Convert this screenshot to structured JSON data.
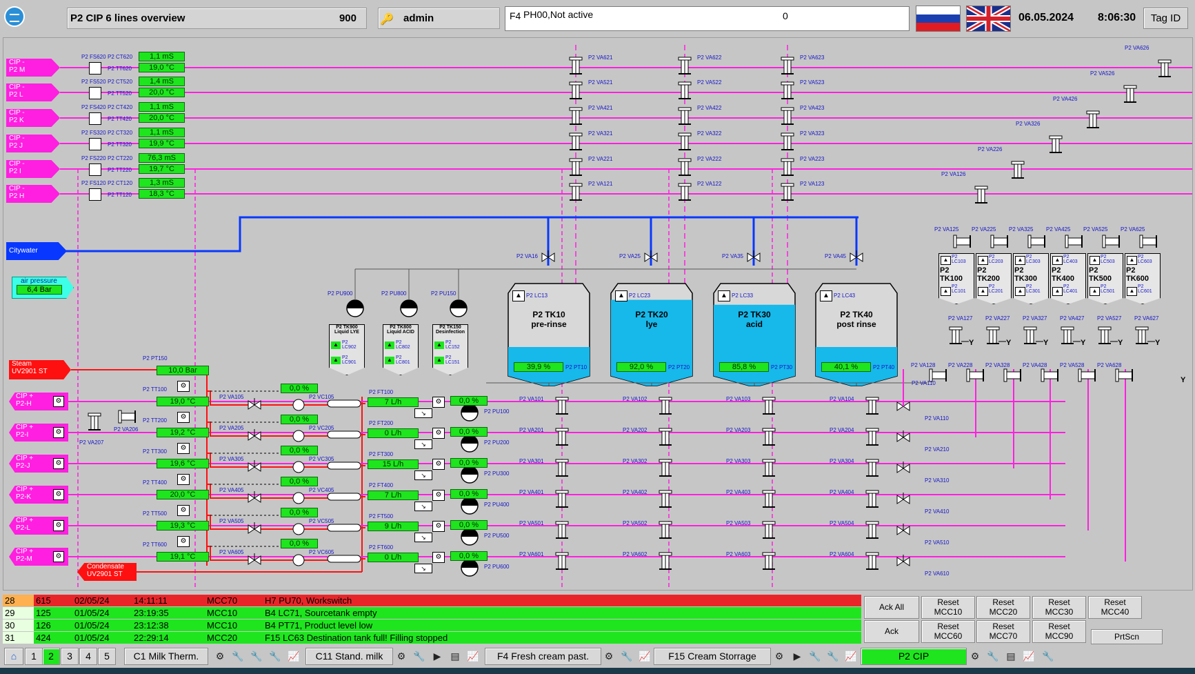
{
  "header": {
    "title": "P2 CIP 6 lines overview",
    "screen_no": "900",
    "user": "admin",
    "alarm_key": "F4",
    "alarm_text": "PH00,Not active",
    "alarm_count": "0",
    "date": "06.05.2024",
    "time": "8:06:30",
    "tag_id_label": "Tag ID"
  },
  "sources": [
    {
      "label1": "CIP -",
      "label2": "P2 M"
    },
    {
      "label1": "CIP -",
      "label2": "P2 L"
    },
    {
      "label1": "CIP -",
      "label2": "P2 K"
    },
    {
      "label1": "CIP -",
      "label2": "P2 J"
    },
    {
      "label1": "CIP -",
      "label2": "P2 I"
    },
    {
      "label1": "CIP -",
      "label2": "P2 H"
    }
  ],
  "return_lines": [
    {
      "fs": "P2 FS620",
      "ct": "P2 CT620",
      "tt": "P2 TT620",
      "ct_val": "1,1 mS",
      "tt_val": "19,0 °C"
    },
    {
      "fs": "P2 FS520",
      "ct": "P2 CT520",
      "tt": "P2 TT520",
      "ct_val": "1,4 mS",
      "tt_val": "20,0 °C"
    },
    {
      "fs": "P2 FS420",
      "ct": "P2 CT420",
      "tt": "P2 TT420",
      "ct_val": "1,1 mS",
      "tt_val": "20,0 °C"
    },
    {
      "fs": "P2 FS320",
      "ct": "P2 CT320",
      "tt": "P2 TT320",
      "ct_val": "1,1 mS",
      "tt_val": "19,9 °C"
    },
    {
      "fs": "P2 FS220",
      "ct": "P2 CT220",
      "tt": "P2 TT220",
      "ct_val": "76,3 mS",
      "tt_val": "19,7 °C"
    },
    {
      "fs": "P2 FS120",
      "ct": "P2 CT120",
      "tt": "P2 TT120",
      "ct_val": "1,3 mS",
      "tt_val": "18,3 °C"
    }
  ],
  "valve_rows": [
    [
      "P2 VA621",
      "P2 VA622",
      "P2 VA623"
    ],
    [
      "P2 VA521",
      "P2 VA522",
      "P2 VA523"
    ],
    [
      "P2 VA421",
      "P2 VA422",
      "P2 VA423"
    ],
    [
      "P2 VA321",
      "P2 VA322",
      "P2 VA323"
    ],
    [
      "P2 VA221",
      "P2 VA222",
      "P2 VA223"
    ],
    [
      "P2 VA121",
      "P2 VA122",
      "P2 VA123"
    ]
  ],
  "right_top_valves": [
    "P2 VA626",
    "P2 VA526",
    "P2 VA426",
    "P2 VA326",
    "P2 VA226",
    "P2 VA126"
  ],
  "citywater": "Citywater",
  "air_pressure": {
    "label": "air pressure",
    "value": "6,4 Bar"
  },
  "steam": {
    "label1": "Steam",
    "label2": "UV2901 ST",
    "pt": "P2 PT150",
    "value": "10,0 Bar"
  },
  "condensate": {
    "label1": "Condensate",
    "label2": "UV2901 ST"
  },
  "water_valves": [
    "P2 VA16",
    "P2 VA25",
    "P2 VA35",
    "P2 VA45"
  ],
  "dosing": [
    {
      "pump": "P2 PU900",
      "name1": "P2 TK900",
      "name2": "Liquid LYE",
      "lc1": "P2 LC902",
      "lc2": "P2 LC901"
    },
    {
      "pump": "P2 PU800",
      "name1": "P2 TK800",
      "name2": "Liquid ACID",
      "lc1": "P2 LC802",
      "lc2": "P2 LC801"
    },
    {
      "pump": "P2 PU150",
      "name1": "P2 TK150",
      "name2": "Desinfection",
      "lc1": "P2 LC152",
      "lc2": "P2 LC151"
    }
  ],
  "tanks": [
    {
      "lc": "P2 LC13",
      "name": "P2 TK10",
      "sub": "pre-rinse",
      "level": "39,9 %",
      "level_pct": 35,
      "pt": "P2 PT10"
    },
    {
      "lc": "P2 LC23",
      "name": "P2 TK20",
      "sub": "lye",
      "level": "92,0 %",
      "level_pct": 92,
      "pt": "P2 PT20"
    },
    {
      "lc": "P2 LC33",
      "name": "P2 TK30",
      "sub": "acid",
      "level": "85,8 %",
      "level_pct": 86,
      "pt": "P2 PT30"
    },
    {
      "lc": "P2 LC43",
      "name": "P2 TK40",
      "sub": "post rinse",
      "level": "40,1 %",
      "level_pct": 35,
      "pt": "P2 PT40"
    }
  ],
  "supply_lines": [
    {
      "label1": "CIP +",
      "label2": "P2-H",
      "tt": "P2 TT100",
      "tt_val": "19,0 °C",
      "va": "P2 VA105",
      "vc": "P2 VC105",
      "vc_val": "0,0 %",
      "ft": "P2 FT100",
      "ft_val": "7 L/h",
      "pu_val": "0,0 %",
      "pu": "P2 PU100",
      "v1": "P2 VA101",
      "v2": "P2 VA102",
      "v3": "P2 VA103",
      "v4": "P2 VA104",
      "vr": "P2 VA110"
    },
    {
      "label1": "CIP +",
      "label2": "P2-I",
      "tt": "P2 TT200",
      "tt_val": "19,2 °C",
      "va": "P2 VA205",
      "vc": "P2 VC205",
      "vc_val": "0,0 %",
      "ft": "P2 FT200",
      "ft_val": "0 L/h",
      "pu_val": "0,0 %",
      "pu": "P2 PU200",
      "v1": "P2 VA201",
      "v2": "P2 VA202",
      "v3": "P2 VA203",
      "v4": "P2 VA204",
      "vr": "P2 VA210"
    },
    {
      "label1": "CIP +",
      "label2": "P2-J",
      "tt": "P2 TT300",
      "tt_val": "19,6 °C",
      "va": "P2 VA305",
      "vc": "P2 VC305",
      "vc_val": "0,0 %",
      "ft": "P2 FT300",
      "ft_val": "15 L/h",
      "pu_val": "0,0 %",
      "pu": "P2 PU300",
      "v1": "P2 VA301",
      "v2": "P2 VA302",
      "v3": "P2 VA303",
      "v4": "P2 VA304",
      "vr": "P2 VA310"
    },
    {
      "label1": "CIP +",
      "label2": "P2-K",
      "tt": "P2 TT400",
      "tt_val": "20,0 °C",
      "va": "P2 VA405",
      "vc": "P2 VC405",
      "vc_val": "0,0 %",
      "ft": "P2 FT400",
      "ft_val": "7 L/h",
      "pu_val": "0,0 %",
      "pu": "P2 PU400",
      "v1": "P2 VA401",
      "v2": "P2 VA402",
      "v3": "P2 VA403",
      "v4": "P2 VA404",
      "vr": "P2 VA410"
    },
    {
      "label1": "CIP +",
      "label2": "P2-L",
      "tt": "P2 TT500",
      "tt_val": "19,3 °C",
      "va": "P2 VA505",
      "vc": "P2 VC505",
      "vc_val": "0,0 %",
      "ft": "P2 FT500",
      "ft_val": "9 L/h",
      "pu_val": "0,0 %",
      "pu": "P2 PU500",
      "v1": "P2 VA501",
      "v2": "P2 VA502",
      "v3": "P2 VA503",
      "v4": "P2 VA504",
      "vr": "P2 VA510"
    },
    {
      "label1": "CIP +",
      "label2": "P2-M",
      "tt": "P2 TT600",
      "tt_val": "19,1 °C",
      "va": "P2 VA605",
      "vc": "P2 VC605",
      "vc_val": "0,0 %",
      "ft": "P2 FT600",
      "ft_val": "0 L/h",
      "pu_val": "0,0 %",
      "pu": "P2 PU600",
      "v1": "P2 VA601",
      "v2": "P2 VA602",
      "v3": "P2 VA603",
      "v4": "P2 VA604",
      "vr": "P2 VA610"
    }
  ],
  "cross_valves": {
    "va206": "P2 VA206",
    "va207": "P2 VA207"
  },
  "small_tanks": [
    {
      "name1": "P2",
      "name2": "TK100",
      "lc1": "P2 LC103",
      "lc2": "P2 LC101",
      "top": "P2 VA125",
      "v27": "P2 VA127",
      "v28": "P2 VA128"
    },
    {
      "name1": "P2",
      "name2": "TK200",
      "lc1": "P2 LC203",
      "lc2": "P2 LC201",
      "top": "P2 VA225",
      "v27": "P2 VA227",
      "v28": "P2 VA228"
    },
    {
      "name1": "P2",
      "name2": "TK300",
      "lc1": "P2 LC303",
      "lc2": "P2 LC301",
      "top": "P2 VA325",
      "v27": "P2 VA327",
      "v28": "P2 VA328"
    },
    {
      "name1": "P2",
      "name2": "TK400",
      "lc1": "P2 LC403",
      "lc2": "P2 LC401",
      "top": "P2 VA425",
      "v27": "P2 VA427",
      "v28": "P2 VA428"
    },
    {
      "name1": "P2",
      "name2": "TK500",
      "lc1": "P2 LC503",
      "lc2": "P2 LC501",
      "top": "P2 VA525",
      "v27": "P2 VA527",
      "v28": "P2 VA528"
    },
    {
      "name1": "P2",
      "name2": "TK600",
      "lc1": "P2 LC603",
      "lc2": "P2 LC601",
      "top": "P2 VA625",
      "v27": "P2 VA627",
      "v28": "P2 VA628"
    }
  ],
  "alarm_rows": [
    {
      "no": "28",
      "code": "615",
      "date": "02/05/24",
      "time": "14:11:11",
      "unit": "MCC70",
      "text": "H7 PU70, Workswitch",
      "color": "#e8262a"
    },
    {
      "no": "29",
      "code": "125",
      "date": "01/05/24",
      "time": "23:19:35",
      "unit": "MCC10",
      "text": "B4 LC71, Sourcetank empty",
      "color": "#1ee51e"
    },
    {
      "no": "30",
      "code": "126",
      "date": "01/05/24",
      "time": "23:12:38",
      "unit": "MCC10",
      "text": "B4 PT71, Product level low",
      "color": "#1ee51e"
    },
    {
      "no": "31",
      "code": "424",
      "date": "01/05/24",
      "time": "22:29:14",
      "unit": "MCC20",
      "text": "F15 LC63 Destination tank full! Filling stopped",
      "color": "#1ee51e"
    }
  ],
  "alarm_buttons": {
    "ack_all": "Ack All",
    "ack": "Ack",
    "prtscn": "PrtScn",
    "reset": [
      {
        "l1": "Reset",
        "l2": "MCC10"
      },
      {
        "l1": "Reset",
        "l2": "MCC20"
      },
      {
        "l1": "Reset",
        "l2": "MCC30"
      },
      {
        "l1": "Reset",
        "l2": "MCC40"
      },
      {
        "l1": "Reset",
        "l2": "MCC60"
      },
      {
        "l1": "Reset",
        "l2": "MCC70"
      },
      {
        "l1": "Reset",
        "l2": "MCC90"
      }
    ]
  },
  "nav": {
    "pages": [
      "1",
      "2",
      "3",
      "4",
      "5"
    ],
    "active_page": "2",
    "screens": [
      "C1 Milk Therm.",
      "C11 Stand. milk",
      "F4 Fresh cream past.",
      "F15 Cream Storrage",
      "P2 CIP"
    ],
    "active_screen": "P2 CIP"
  },
  "colors": {
    "cip_pink": "#ff1fe0",
    "water_blue": "#0838ff",
    "steam_red": "#ff1010",
    "value_green": "#1ee51e",
    "tank_liquid": "#17b8ea",
    "label_blue": "#1515c8"
  }
}
